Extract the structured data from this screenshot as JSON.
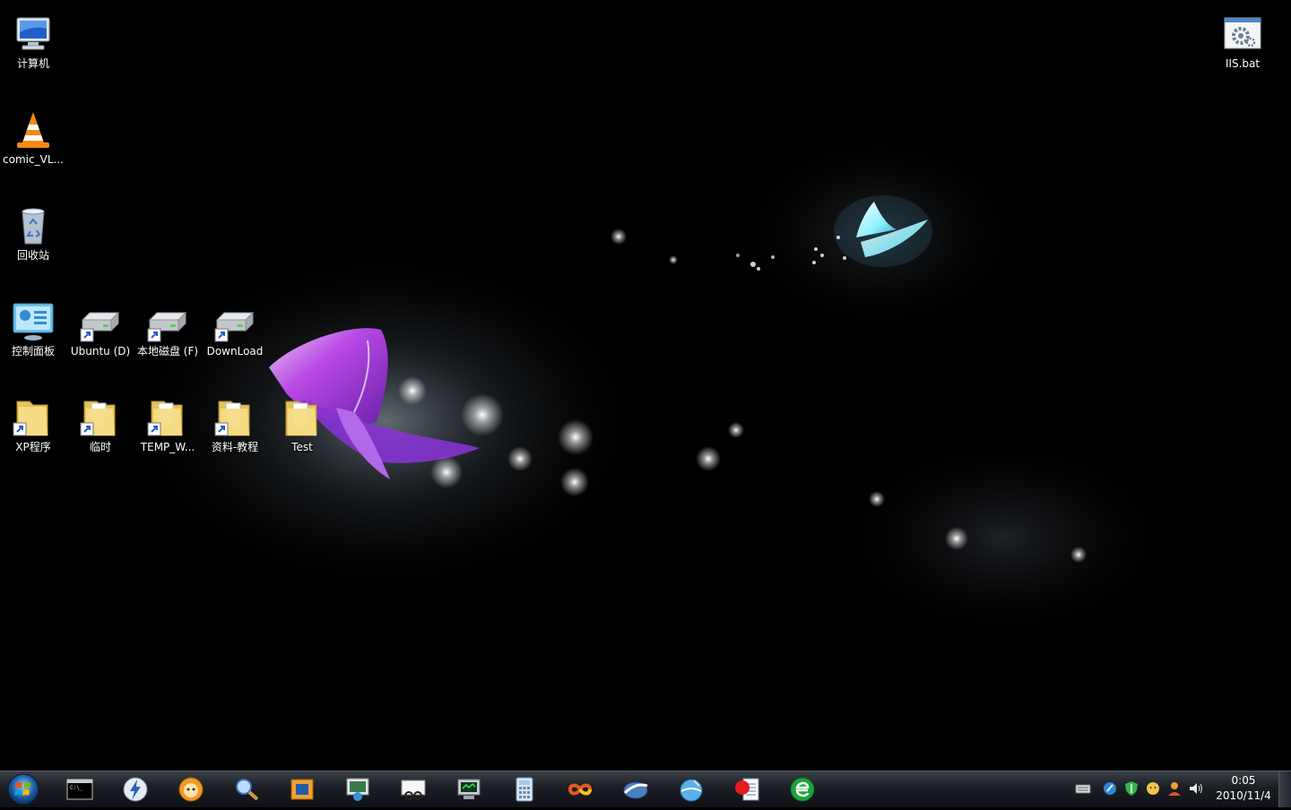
{
  "desktop": {
    "icons": [
      {
        "label": "计算机"
      },
      {
        "label": "comic_VL..."
      },
      {
        "label": "回收站"
      },
      {
        "label": "控制面板"
      },
      {
        "label": "Ubuntu (D)"
      },
      {
        "label": "本地磁盘 (F)"
      },
      {
        "label": "DownLoad"
      },
      {
        "label": "XP程序"
      },
      {
        "label": "临时"
      },
      {
        "label": "TEMP_W..."
      },
      {
        "label": "资料-教程"
      },
      {
        "label": "Test"
      },
      {
        "label": "IIS.bat"
      }
    ]
  },
  "taskbar": {
    "pinned_icons": [
      "command-prompt-icon",
      "lightning-app-icon",
      "media-player-face-icon",
      "search-magnifier-icon",
      "virtualbox-icon",
      "network-monitor-icon",
      "glasses-viewer-icon",
      "terminal-monitor-icon",
      "calculator-icon",
      "infinity-app-icon",
      "disc-swoosh-icon",
      "round-app-icon",
      "record-document-icon",
      "green-browser-icon"
    ],
    "tray_icons": [
      "keyboard-icon",
      "blue-circle-icon",
      "shield-icon",
      "face-icon",
      "user-icon",
      "volume-icon"
    ],
    "clock": {
      "time": "0:05",
      "date": "2010/11/4"
    }
  },
  "colors": {
    "background": "#000000",
    "butterfly_purple": "#c24cf0",
    "butterfly_cyan": "#8ff0ff"
  }
}
